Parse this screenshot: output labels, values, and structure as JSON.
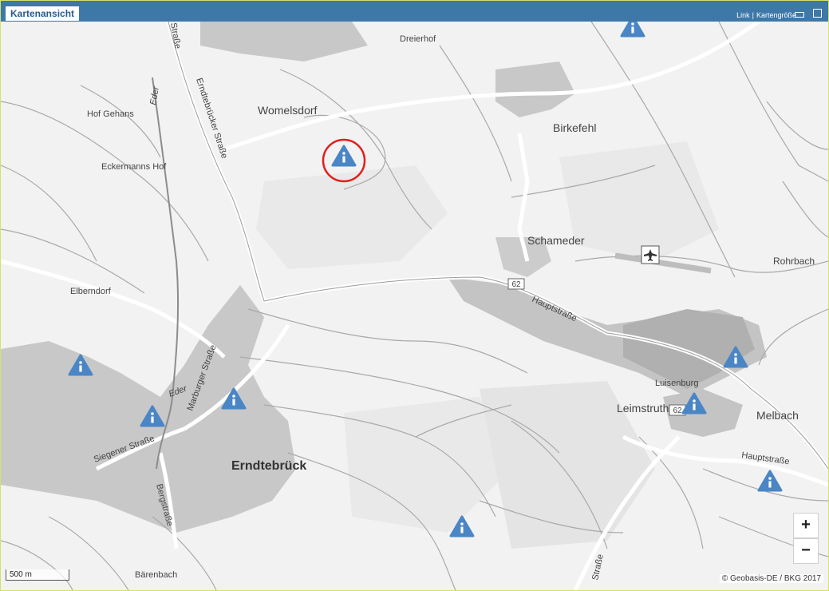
{
  "window": {
    "title": "Kartenansicht",
    "link_label": "Link",
    "separator": "|",
    "size_label": "Kartengröße"
  },
  "map": {
    "places": {
      "dreierhof": "Dreierhof",
      "womelsdorf": "Womelsdorf",
      "hof_gehans": "Hof Gehans",
      "eckermanns_hof": "Eckermanns Hof",
      "birkefehl": "Birkefehl",
      "schameder": "Schameder",
      "rohrbach": "Rohrbach",
      "elberndorf": "Elberndorf",
      "luisenburg": "Luisenburg",
      "leimstruth": "Leimstruth",
      "melbach": "Melbach",
      "erndtebrueck": "Erndtebrück",
      "baerenbach": "Bärenbach"
    },
    "streets": {
      "erndtebruecker_strasse": "Erndtebrücker Straße",
      "hauptstrasse_1": "Hauptstraße",
      "hauptstrasse_2": "Hauptstraße",
      "marburger_strasse": "Marburger Straße",
      "siegener_strasse": "Siegener Straße",
      "bergstrasse": "Bergstraße",
      "strasse_top": "Straße",
      "strasse_bottom": "Straße",
      "eder_1": "Eder",
      "eder_2": "Eder"
    },
    "road_shields": {
      "b62_north": "62",
      "b62_east": "62"
    },
    "controls": {
      "zoom_in": "+",
      "zoom_out": "−"
    },
    "scale_label": "500 m",
    "attribution": "© Geobasis-DE / BKG 2017",
    "colors": {
      "marker": "#4a86c5",
      "highlight": "#e0201b",
      "titlebar": "#3e78a8"
    }
  }
}
